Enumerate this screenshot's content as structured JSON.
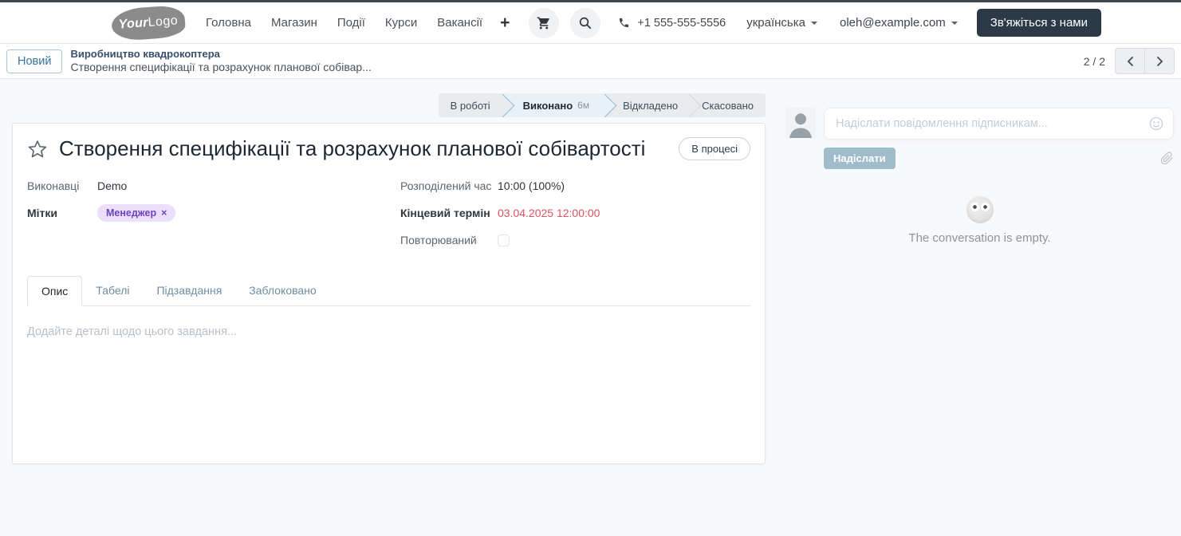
{
  "header": {
    "logo_part1": "Your",
    "logo_part2": "Logo",
    "nav_items": [
      "Головна",
      "Магазин",
      "Події",
      "Курси",
      "Вакансії"
    ],
    "plus_label": "+",
    "phone": "+1 555-555-5556",
    "language": "українська",
    "account": "oleh@example.com",
    "cta_label": "Зв'яжіться з нами"
  },
  "breadcrumb": {
    "new_button": "Новий",
    "project": "Виробництво квадрокоптера",
    "task": "Створення специфікації та розрахунок планової собівар...",
    "pager_count": "2 / 2"
  },
  "statusbar": {
    "steps": [
      {
        "label": "В роботі"
      },
      {
        "label": "Виконано",
        "duration": "6м",
        "active": true
      },
      {
        "label": "Відкладено"
      },
      {
        "label": "Скасовано"
      }
    ]
  },
  "task": {
    "title": "Створення специфікації та розрахунок планової собівартості",
    "state_badge": "В процесі",
    "fields": {
      "assignees_label": "Виконавці",
      "assignees_value": "Demo",
      "tags_label": "Мітки",
      "tag_value": "Менеджер",
      "tag_remove": "×",
      "allocated_label": "Розподілений час",
      "allocated_value": "10:00 (100%)",
      "deadline_label": "Кінцевий термін",
      "deadline_value": "03.04.2025 12:00:00",
      "recurrent_label": "Повторюваний"
    },
    "tabs": [
      "Опис",
      "Табелі",
      "Підзавдання",
      "Заблоковано"
    ],
    "description_placeholder": "Додайте деталі щодо цього завдання..."
  },
  "chatter": {
    "composer_placeholder": "Надіслати повідомлення підписникам...",
    "send_button": "Надіслати",
    "empty_text": "The conversation is empty."
  },
  "icons": {
    "cart": "shopping-cart",
    "search": "magnifier",
    "phone": "phone-handset",
    "star": "favorite-star-outline",
    "smiley": "emoji-smile",
    "paperclip": "attachment",
    "avatar": "person-silhouette",
    "empty_face": "ghost-face"
  },
  "colors": {
    "deadline_red": "#e0515f",
    "tag_bg": "#ebdffb",
    "tag_text": "#6f42c1",
    "cta_dark": "#2c3a47",
    "statusbar_active_bg": "#e8f1f8",
    "statusbar_active_border": "#94b9d4",
    "link_blue": "#35749c",
    "page_bg": "#f8f9fa"
  }
}
